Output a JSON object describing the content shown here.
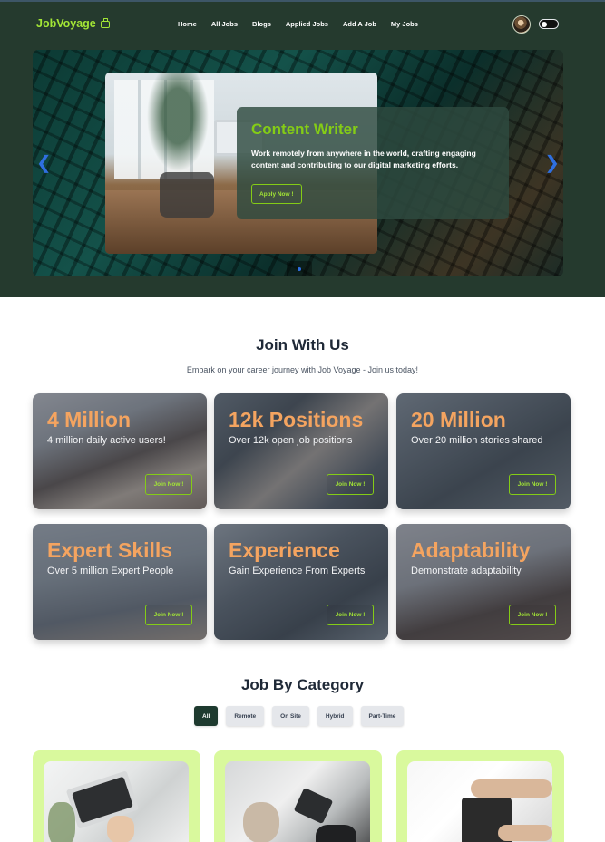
{
  "brand": {
    "name": "JobVoyage",
    "accent": "#a3e635",
    "header_bg": "#253a2e"
  },
  "nav": {
    "links": [
      "Home",
      "All Jobs",
      "Blogs",
      "Applied Jobs",
      "Add A Job",
      "My Jobs"
    ]
  },
  "hero": {
    "title": "Content Writer",
    "description": "Work remotely from anywhere in the world, crafting engaging content and contributing to our digital marketing efforts.",
    "button": "Apply Now !",
    "prev_icon": "chevron-left-icon",
    "next_icon": "chevron-right-icon"
  },
  "join": {
    "title": "Join With Us",
    "subtitle": "Embark on your career journey with Job Voyage - Join us today!",
    "cards": [
      {
        "title": "4 Million",
        "subtitle": "4 million daily active users!",
        "button": "Join Now !"
      },
      {
        "title": "12k Positions",
        "subtitle": "Over 12k open job positions",
        "button": "Join Now !"
      },
      {
        "title": "20 Million",
        "subtitle": "Over 20 million stories shared",
        "button": "Join Now !"
      },
      {
        "title": "Expert Skills",
        "subtitle": "Over 5 million Expert People",
        "button": "Join Now !"
      },
      {
        "title": "Experience",
        "subtitle": "Gain Experience From Experts",
        "button": "Join Now !"
      },
      {
        "title": "Adaptability",
        "subtitle": "Demonstrate adaptability",
        "button": "Join Now !"
      }
    ]
  },
  "category": {
    "title": "Job By Category",
    "filters": [
      "All",
      "Remote",
      "On Site",
      "Hybrid",
      "Part-Time"
    ],
    "active_filter": "All"
  }
}
